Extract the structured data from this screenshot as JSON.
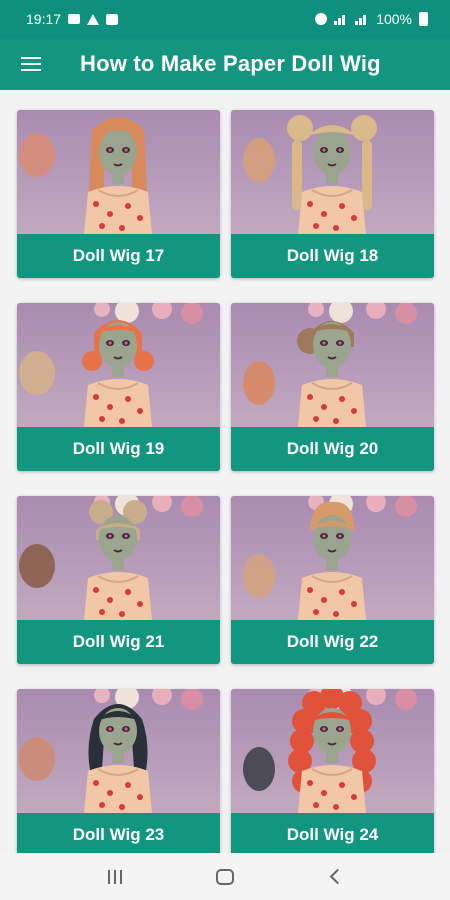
{
  "status_bar": {
    "time": "19:17",
    "battery": "100%",
    "icons_left": [
      "message-icon",
      "alert-icon",
      "mail-icon"
    ],
    "icons_right": [
      "alarm-icon",
      "signal-icon",
      "signal-icon",
      "battery-icon"
    ]
  },
  "app_bar": {
    "title": "How to Make Paper Doll Wig",
    "menu_icon": "hamburger-menu-icon"
  },
  "colors": {
    "teal_primary": "#14957f",
    "teal_status": "#0f8f7e",
    "background_purple": "#b197b6"
  },
  "cards": [
    {
      "label": "Doll Wig 17",
      "hair_color": "#d88a5a",
      "hair_style": "long-straight"
    },
    {
      "label": "Doll Wig 18",
      "hair_color": "#d9b98a",
      "hair_style": "buns-braids"
    },
    {
      "label": "Doll Wig 19",
      "hair_color": "#e8734a",
      "hair_style": "short-pigtails"
    },
    {
      "label": "Doll Wig 20",
      "hair_color": "#9c7a5a",
      "hair_style": "side-bun"
    },
    {
      "label": "Doll Wig 21",
      "hair_color": "#c9ad8a",
      "hair_style": "space-buns"
    },
    {
      "label": "Doll Wig 22",
      "hair_color": "#d99a6a",
      "hair_style": "updo"
    },
    {
      "label": "Doll Wig 23",
      "hair_color": "#2a3038",
      "hair_style": "long-wavy"
    },
    {
      "label": "Doll Wig 24",
      "hair_color": "#e0533a",
      "hair_style": "curly"
    }
  ],
  "nav_bar": {
    "buttons": [
      "recents-icon",
      "home-icon",
      "back-icon"
    ]
  }
}
